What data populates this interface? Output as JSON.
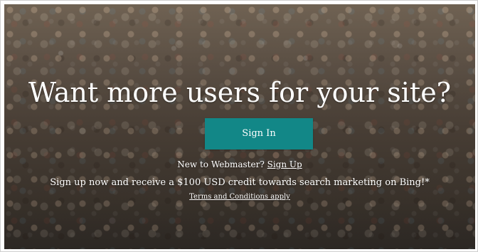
{
  "hero": {
    "headline": "Want more users for your site?",
    "sign_in_label": "Sign In",
    "new_user_prefix": "New to Webmaster?",
    "sign_up_label": "Sign Up",
    "promo_text": "Sign up now and receive a $100 USD credit towards search marketing on Bing!*",
    "terms_label": "Terms and Conditions apply"
  },
  "colors": {
    "primary_button": "#128787",
    "text": "#ffffff"
  }
}
